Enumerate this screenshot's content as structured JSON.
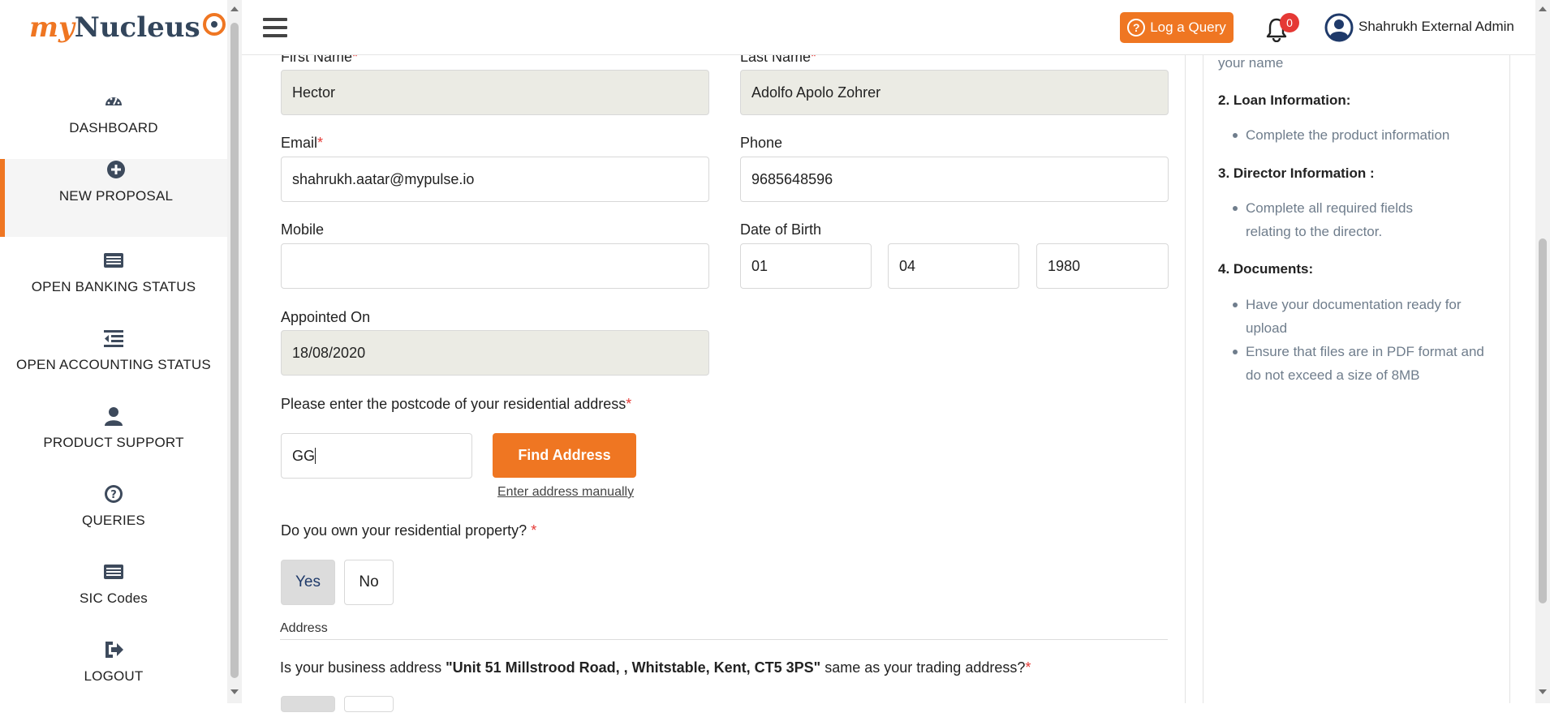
{
  "brand": {
    "logo_my": "my",
    "logo_nucleus": "Nucleus",
    "accent": "#ef7622"
  },
  "sidebar": {
    "items": [
      {
        "label": "DASHBOARD",
        "icon": "gauge-icon"
      },
      {
        "label": "NEW PROPOSAL",
        "icon": "plus-circle-icon"
      },
      {
        "label": "OPEN BANKING STATUS",
        "icon": "list-card-icon"
      },
      {
        "label": "OPEN ACCOUNTING STATUS",
        "icon": "indent-list-icon"
      },
      {
        "label": "PRODUCT SUPPORT",
        "icon": "user-icon"
      },
      {
        "label": "QUERIES",
        "icon": "question-circle-icon"
      },
      {
        "label": "SIC Codes",
        "icon": "list-card-icon"
      },
      {
        "label": "LOGOUT",
        "icon": "sign-out-icon"
      }
    ]
  },
  "header": {
    "log_query_label": "Log a Query",
    "notification_count": "0",
    "user_name": "Shahrukh External Admin"
  },
  "form": {
    "first_name_label": "First Name",
    "first_name_value": "Hector",
    "last_name_label": "Last Name",
    "last_name_value": "Adolfo Apolo Zohrer",
    "email_label": "Email",
    "email_value": "shahrukh.aatar@mypulse.io",
    "phone_label": "Phone",
    "phone_value": "9685648596",
    "mobile_label": "Mobile",
    "mobile_value": "",
    "dob_label": "Date of Birth",
    "dob_day": "01",
    "dob_month": "04",
    "dob_year": "1980",
    "appointed_label": "Appointed On",
    "appointed_value": "18/08/2020",
    "postcode_label": "Please enter the postcode of your residential address",
    "postcode_value": "GG",
    "find_address_label": "Find Address",
    "manual_address_label": "Enter address manually",
    "own_property_label": "Do you own your residential property?",
    "yes_label": "Yes",
    "no_label": "No",
    "address_section_title": "Address",
    "business_q_prefix": "Is your business address ",
    "business_address": "\"Unit 51 Millstrood Road, , Whitstable, Kent, CT5 3PS\"",
    "business_q_suffix": " same as your trading address?",
    "required_mark": "*"
  },
  "info": {
    "name_tail": "your name",
    "sections": [
      {
        "heading": "2. Loan Information:",
        "items": [
          "Complete the product information"
        ]
      },
      {
        "heading": "3. Director Information :",
        "items": [
          "Complete all required fields relating to the director."
        ]
      },
      {
        "heading": "4. Documents:",
        "items": [
          "Have your documentation ready for upload",
          "Ensure that files are in PDF format and do not exceed a size of 8MB"
        ]
      }
    ]
  }
}
